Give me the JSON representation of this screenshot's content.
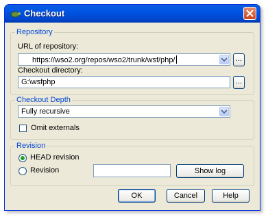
{
  "window": {
    "title": "Checkout"
  },
  "repository": {
    "legend": "Repository",
    "url_label": "URL of repository:",
    "url_value": "https://wso2.org/repos/wso2/trunk/wsf/php/",
    "browse_label": "...",
    "dir_label": "Checkout directory:",
    "dir_value": "G:\\wsfphp",
    "dir_browse_label": "..."
  },
  "depth": {
    "legend": "Checkout Depth",
    "selected": "Fully recursive",
    "omit_label": "Omit externals",
    "omit_checked": false
  },
  "revision": {
    "legend": "Revision",
    "head_label": "HEAD revision",
    "head_selected": true,
    "rev_label": "Revision",
    "rev_value": "",
    "show_log_label": "Show log"
  },
  "buttons": {
    "ok": "OK",
    "cancel": "Cancel",
    "help": "Help"
  },
  "colors": {
    "title_bar": "#0054e3",
    "dialog_bg": "#ece9d8",
    "group_legend": "#0046d5"
  }
}
